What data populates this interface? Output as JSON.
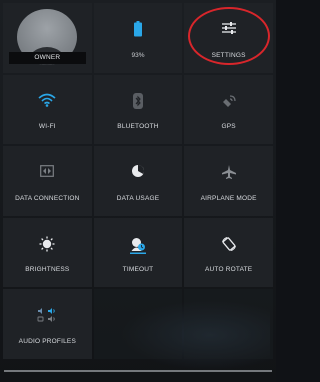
{
  "tiles": {
    "owner": {
      "label": "OWNER"
    },
    "battery": {
      "label": "93%",
      "icon": "battery-icon",
      "color": "#2aa7e8"
    },
    "settings": {
      "label": "SETTINGS",
      "icon": "sliders-icon"
    },
    "wifi": {
      "label": "WI-FI",
      "icon": "wifi-icon",
      "color": "#2aa7e8"
    },
    "bluetooth": {
      "label": "BLUETOOTH",
      "icon": "bluetooth-icon"
    },
    "gps": {
      "label": "GPS",
      "icon": "gps-icon"
    },
    "data_connection": {
      "label": "DATA CONNECTION",
      "icon": "data-connection-icon"
    },
    "data_usage": {
      "label": "DATA USAGE",
      "icon": "data-usage-icon"
    },
    "airplane_mode": {
      "label": "AIRPLANE MODE",
      "icon": "airplane-icon"
    },
    "brightness": {
      "label": "BRIGHTNESS",
      "icon": "brightness-icon"
    },
    "timeout": {
      "label": "TIMEOUT",
      "icon": "timeout-icon",
      "color": "#2aa7e8"
    },
    "auto_rotate": {
      "label": "AUTO ROTATE",
      "icon": "auto-rotate-icon"
    },
    "audio_profiles": {
      "label": "AUDIO PROFILES",
      "icon": "audio-profiles-icon",
      "color": "#2aa7e8"
    }
  },
  "annotation": {
    "color": "#d8262b"
  }
}
